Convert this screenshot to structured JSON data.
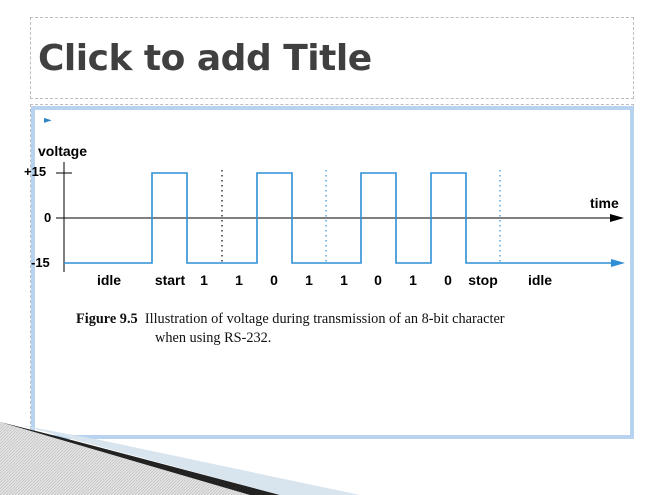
{
  "slide": {
    "title_placeholder": "Click to add Title"
  },
  "figure": {
    "ylabel": "voltage",
    "xlabel": "time",
    "y_ticks": [
      "+15",
      "0",
      "-15"
    ],
    "bit_labels": [
      "idle",
      "start",
      "1",
      "1",
      "0",
      "1",
      "1",
      "0",
      "1",
      "0",
      "stop",
      "idle"
    ],
    "caption_label": "Figure 9.5",
    "caption_line1": "Illustration of voltage during transmission of an 8-bit character",
    "caption_line2": "when using RS-232."
  },
  "colors": {
    "signal": "#2f8fd6",
    "frame": "#b8d3f0",
    "title": "#404040",
    "axis": "#000000"
  },
  "chart_data": {
    "type": "line",
    "ylabel": "voltage",
    "xlabel": "time",
    "ylim": [
      -15,
      15
    ],
    "y_ticks": [
      15,
      0,
      -15
    ],
    "categories": [
      "idle",
      "start",
      "1",
      "1",
      "0",
      "1",
      "1",
      "0",
      "1",
      "0",
      "stop",
      "idle"
    ],
    "series": [
      {
        "values": [
          -15,
          15,
          -15,
          -15,
          15,
          -15,
          -15,
          15,
          -15,
          15,
          -15,
          -15
        ]
      }
    ]
  }
}
